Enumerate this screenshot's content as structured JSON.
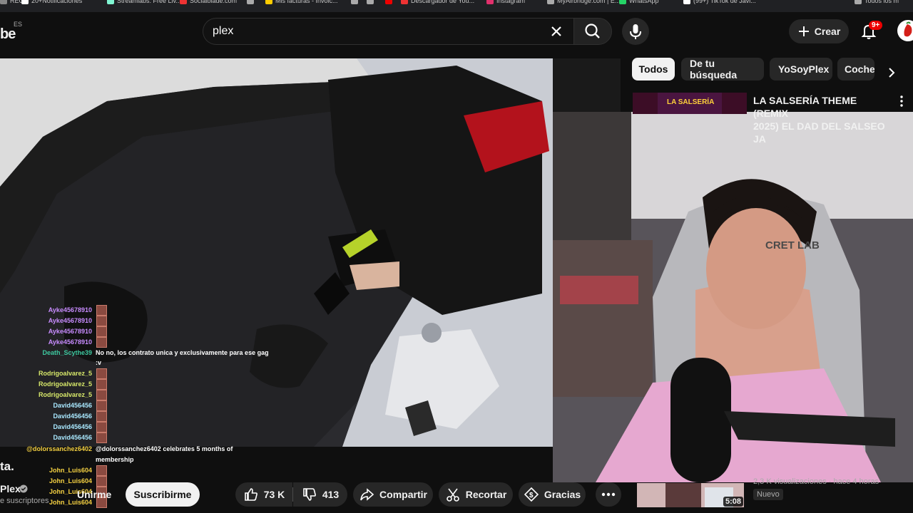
{
  "bookmarks": [
    {
      "label": "REC",
      "color": "#888"
    },
    {
      "label": "20+Notificaciones",
      "color": "#fff"
    },
    {
      "label": "Streamlabs: Free Liv...",
      "color": "#80f5d2"
    },
    {
      "label": "Socialblade.com",
      "color": "#e33"
    },
    {
      "label": "",
      "color": "#aaa"
    },
    {
      "label": "Mis facturas - Invoic...",
      "color": "#ffcc00"
    },
    {
      "label": "",
      "color": "#aaa"
    },
    {
      "label": "",
      "color": "#aaa"
    },
    {
      "label": "",
      "color": "#e00"
    },
    {
      "label": "Descargador de You...",
      "color": "#e33"
    },
    {
      "label": "Instagram",
      "color": "#e1306c"
    },
    {
      "label": "MyAirbridge.com | E...",
      "color": "#aaa"
    },
    {
      "label": "WhatsApp",
      "color": "#25d366"
    },
    {
      "label": "(99+) TikTok de Javi...",
      "color": "#fff"
    },
    {
      "label": "Todos los m",
      "color": "#aaa"
    }
  ],
  "header": {
    "logo_fragment": "be",
    "country_code": "ES",
    "search_value": "plex",
    "create_label": "Crear",
    "notif_badge": "9+"
  },
  "chips": [
    "Todos",
    "De tu búsqueda",
    "YoSoyPlex",
    "Coche"
  ],
  "recommendation": {
    "title_line1": "LA SALSERÍA THEME (REMIX",
    "title_line2": "2025) EL DAD DEL SALSEO JA",
    "thumb_text": "LA SALSERÍA"
  },
  "bottom_rec": {
    "duration": "5:08",
    "badge": "Nuevo",
    "views": "2,3 K visualizaciones · hace 4 horas"
  },
  "video": {
    "title_fragment": "ta.",
    "channel": "Plex",
    "subscribers": "e suscriptores",
    "subscribe_label": "Suscribirme",
    "unirme_fragment": "Unirme",
    "likes": "73 K",
    "dislikes": "413",
    "share_label": "Compartir",
    "clip_label": "Recortar",
    "thanks_label": "Gracias",
    "cam_logo": "CRET LAB"
  },
  "chat": [
    {
      "user": "Ayke45678910",
      "color": "#c88cff",
      "msg": ""
    },
    {
      "user": "Ayke45678910",
      "color": "#c88cff",
      "msg": ""
    },
    {
      "user": "Ayke45678910",
      "color": "#c88cff",
      "msg": ""
    },
    {
      "user": "Ayke45678910",
      "color": "#c88cff",
      "msg": ""
    },
    {
      "user": "Death_Scythe39",
      "color": "#3ec9a0",
      "msg": "No no, los contrato unica y exclusivamente para ese gag"
    },
    {
      "user": "",
      "color": "#fff",
      "msg": ":v"
    },
    {
      "user": "Rodrigoalvarez_5",
      "color": "#d7e86a",
      "msg": ""
    },
    {
      "user": "Rodrigoalvarez_5",
      "color": "#d7e86a",
      "msg": ""
    },
    {
      "user": "Rodrigoalvarez_5",
      "color": "#d7e86a",
      "msg": ""
    },
    {
      "user": "David456456",
      "color": "#a9e8ff",
      "msg": ""
    },
    {
      "user": "David456456",
      "color": "#a9e8ff",
      "msg": ""
    },
    {
      "user": "David456456",
      "color": "#a9e8ff",
      "msg": ""
    },
    {
      "user": "David456456",
      "color": "#a9e8ff",
      "msg": ""
    },
    {
      "user": "@dolorssanchez6402",
      "color": "#f5d142",
      "msg": "@dolorssanchez6402 celebrates 5 months of"
    },
    {
      "user": "",
      "color": "#fff",
      "msg": "membership"
    },
    {
      "user": "John_Luis604",
      "color": "#f5d142",
      "msg": ""
    },
    {
      "user": "John_Luis604",
      "color": "#f5d142",
      "msg": ""
    },
    {
      "user": "John_Luis604",
      "color": "#f5d142",
      "msg": ""
    },
    {
      "user": "John_Luis604",
      "color": "#f5d142",
      "msg": ""
    }
  ]
}
